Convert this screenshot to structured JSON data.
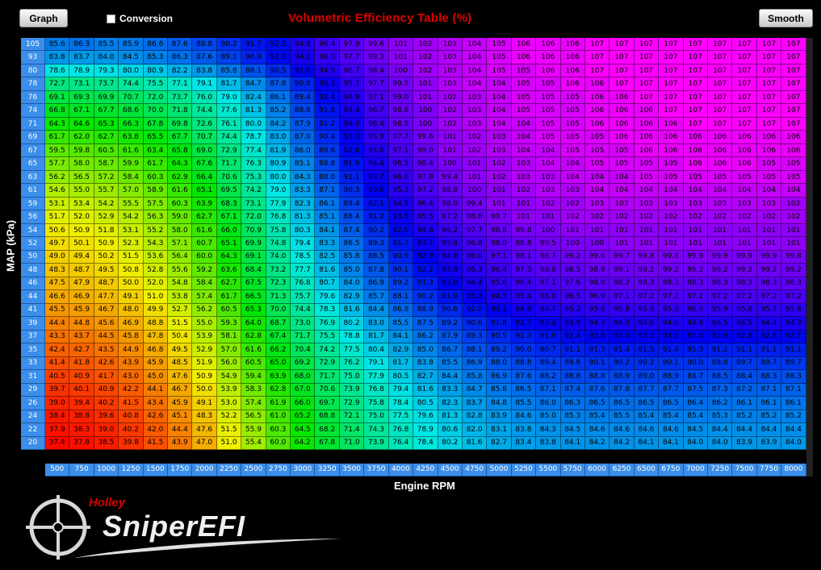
{
  "toolbar": {
    "graph_label": "Graph",
    "conversion_label": "Conversion",
    "smooth_label": "Smooth"
  },
  "title": "Volumetric Efficiency Table (%)",
  "y_axis_label": "MAP (kPa)",
  "x_axis_label": "Engine RPM",
  "logo": {
    "brand": "Holley",
    "name": "SniperEFI"
  },
  "icons": {
    "logo_mark": "crosshair-icon"
  },
  "table": {
    "rpm": [
      "500",
      "750",
      "1000",
      "1250",
      "1500",
      "1750",
      "2000",
      "2250",
      "2500",
      "2750",
      "3000",
      "3250",
      "3500",
      "3750",
      "4000",
      "4250",
      "4500",
      "4750",
      "5000",
      "5250",
      "5500",
      "5750",
      "6000",
      "6250",
      "6500",
      "6750",
      "7000",
      "7250",
      "7500",
      "7750",
      "8000"
    ],
    "map": [
      "105",
      "93",
      "80",
      "78",
      "76",
      "74",
      "71",
      "69",
      "67",
      "65",
      "63",
      "61",
      "59",
      "56",
      "54",
      "52",
      "50",
      "48",
      "46",
      "44",
      "41",
      "39",
      "37",
      "35",
      "33",
      "31",
      "29",
      "26",
      "24",
      "22",
      "20"
    ],
    "rows": [
      [
        "85.6",
        "86.3",
        "85.5",
        "85.9",
        "86.6",
        "87.6",
        "88.8",
        "90.2",
        "91.7",
        "92.3",
        "94.8",
        "96.4",
        "97.9",
        "99.6",
        "101",
        "102",
        "103",
        "104",
        "105",
        "106",
        "106",
        "106",
        "107",
        "107",
        "107",
        "107",
        "107",
        "107",
        "107",
        "107",
        "107"
      ],
      [
        "83.8",
        "83.7",
        "84.0",
        "84.5",
        "85.3",
        "86.3",
        "87.6",
        "89.1",
        "90.9",
        "92.5",
        "94.2",
        "96.0",
        "97.7",
        "99.3",
        "101",
        "102",
        "103",
        "104",
        "105",
        "106",
        "106",
        "106",
        "107",
        "107",
        "107",
        "107",
        "107",
        "107",
        "107",
        "107",
        "107"
      ],
      [
        "78.6",
        "78.9",
        "79.3",
        "80.0",
        "80.9",
        "82.2",
        "83.8",
        "85.8",
        "88.1",
        "90.5",
        "92.8",
        "94.9",
        "96.7",
        "98.4",
        "100",
        "102",
        "103",
        "104",
        "105",
        "105",
        "106",
        "106",
        "107",
        "107",
        "107",
        "107",
        "107",
        "107",
        "107",
        "107",
        "107"
      ],
      [
        "72.7",
        "73.1",
        "73.7",
        "74.4",
        "75.5",
        "77.1",
        "79.1",
        "81.7",
        "84.7",
        "87.8",
        "90.8",
        "93.5",
        "95.7",
        "97.7",
        "99.5",
        "101",
        "103",
        "104",
        "104",
        "105",
        "105",
        "106",
        "106",
        "107",
        "107",
        "107",
        "107",
        "107",
        "107",
        "107",
        "107"
      ],
      [
        "69.1",
        "69.3",
        "69.9",
        "70.7",
        "72.0",
        "73.7",
        "76.0",
        "79.0",
        "82.4",
        "86.1",
        "89.4",
        "92.4",
        "94.9",
        "97.1",
        "99.0",
        "101",
        "102",
        "103",
        "104",
        "105",
        "105",
        "105",
        "106",
        "106",
        "107",
        "107",
        "107",
        "107",
        "107",
        "107",
        "107"
      ],
      [
        "66.8",
        "67.1",
        "67.7",
        "68.6",
        "70.0",
        "71.8",
        "74.4",
        "77.6",
        "81.3",
        "85.2",
        "88.8",
        "91.8",
        "94.4",
        "96.7",
        "98.8",
        "100",
        "102",
        "103",
        "104",
        "105",
        "105",
        "105",
        "106",
        "106",
        "106",
        "107",
        "107",
        "107",
        "107",
        "107",
        "107"
      ],
      [
        "64.3",
        "64.6",
        "65.3",
        "66.3",
        "67.8",
        "69.8",
        "72.6",
        "76.1",
        "80.0",
        "84.2",
        "87.9",
        "91.2",
        "94.0",
        "96.4",
        "98.5",
        "100",
        "102",
        "103",
        "104",
        "104",
        "105",
        "105",
        "106",
        "106",
        "106",
        "106",
        "107",
        "107",
        "107",
        "107",
        "107"
      ],
      [
        "61.7",
        "62.0",
        "62.7",
        "63.8",
        "65.5",
        "67.7",
        "70.7",
        "74.4",
        "78.7",
        "83.0",
        "87.0",
        "90.4",
        "93.3",
        "95.9",
        "97.7",
        "99.6",
        "101",
        "102",
        "103",
        "104",
        "105",
        "105",
        "105",
        "106",
        "106",
        "106",
        "106",
        "106",
        "106",
        "106",
        "106"
      ],
      [
        "59.5",
        "59.8",
        "60.5",
        "61.6",
        "63.4",
        "65.8",
        "69.0",
        "72.9",
        "77.4",
        "81.9",
        "86.0",
        "89.6",
        "92.6",
        "95.0",
        "97.1",
        "99.0",
        "101",
        "102",
        "103",
        "104",
        "104",
        "105",
        "105",
        "105",
        "106",
        "106",
        "106",
        "106",
        "106",
        "106",
        "106"
      ],
      [
        "57.7",
        "58.0",
        "58.7",
        "59.9",
        "61.7",
        "64.3",
        "67.6",
        "71.7",
        "76.3",
        "80.9",
        "85.1",
        "88.8",
        "91.9",
        "94.4",
        "96.5",
        "98.4",
        "100",
        "101",
        "102",
        "103",
        "104",
        "104",
        "105",
        "105",
        "105",
        "105",
        "106",
        "106",
        "106",
        "105",
        "105"
      ],
      [
        "56.2",
        "56.5",
        "57.2",
        "58.4",
        "60.3",
        "62.9",
        "66.4",
        "70.6",
        "75.3",
        "80.0",
        "84.3",
        "88.0",
        "91.1",
        "93.7",
        "96.0",
        "97.8",
        "99.4",
        "101",
        "102",
        "103",
        "103",
        "104",
        "104",
        "104",
        "105",
        "105",
        "105",
        "105",
        "105",
        "105",
        "105"
      ],
      [
        "54.6",
        "55.0",
        "55.7",
        "57.0",
        "58.9",
        "61.6",
        "65.1",
        "69.5",
        "74.2",
        "79.0",
        "83.3",
        "87.1",
        "90.3",
        "93.0",
        "95.3",
        "97.2",
        "98.8",
        "100",
        "101",
        "102",
        "103",
        "103",
        "104",
        "104",
        "104",
        "104",
        "104",
        "104",
        "104",
        "104",
        "104"
      ],
      [
        "53.1",
        "53.4",
        "54.2",
        "55.5",
        "57.5",
        "60.3",
        "63.9",
        "68.3",
        "73.1",
        "77.9",
        "82.3",
        "86.1",
        "89.4",
        "92.1",
        "94.5",
        "96.4",
        "98.0",
        "99.4",
        "101",
        "101",
        "102",
        "102",
        "103",
        "103",
        "103",
        "103",
        "103",
        "103",
        "103",
        "103",
        "102"
      ],
      [
        "51.7",
        "52.0",
        "52.9",
        "54.2",
        "56.3",
        "59.0",
        "62.7",
        "67.1",
        "72.0",
        "76.8",
        "81.3",
        "85.1",
        "88.4",
        "91.2",
        "93.6",
        "95.5",
        "97.2",
        "98.6",
        "99.7",
        "101",
        "101",
        "102",
        "102",
        "102",
        "102",
        "102",
        "102",
        "102",
        "102",
        "102",
        "102"
      ],
      [
        "50.6",
        "50.9",
        "51.8",
        "53.1",
        "55.2",
        "58.0",
        "61.6",
        "66.0",
        "70.9",
        "75.8",
        "80.3",
        "84.1",
        "87.4",
        "90.2",
        "92.6",
        "94.6",
        "96.2",
        "97.7",
        "98.8",
        "99.8",
        "100",
        "101",
        "101",
        "101",
        "101",
        "101",
        "101",
        "101",
        "101",
        "101",
        "101"
      ],
      [
        "49.7",
        "50.1",
        "50.9",
        "52.3",
        "54.3",
        "57.1",
        "60.7",
        "65.1",
        "69.9",
        "74.8",
        "79.4",
        "83.3",
        "86.5",
        "89.3",
        "91.7",
        "93.7",
        "95.4",
        "96.8",
        "98.0",
        "98.8",
        "99.5",
        "100",
        "100",
        "101",
        "101",
        "101",
        "101",
        "101",
        "101",
        "101",
        "101"
      ],
      [
        "49.0",
        "49.4",
        "50.2",
        "51.5",
        "53.6",
        "56.4",
        "60.0",
        "64.3",
        "69.1",
        "74.0",
        "78.5",
        "82.5",
        "85.8",
        "88.5",
        "90.9",
        "92.9",
        "94.6",
        "96.0",
        "97.1",
        "98.1",
        "98.7",
        "99.2",
        "99.6",
        "99.7",
        "99.8",
        "99.8",
        "99.9",
        "99.9",
        "99.9",
        "99.9",
        "99.8"
      ],
      [
        "48.3",
        "48.7",
        "49.5",
        "50.8",
        "52.8",
        "55.6",
        "59.2",
        "63.6",
        "68.4",
        "73.2",
        "77.7",
        "81.6",
        "85.0",
        "87.8",
        "90.1",
        "92.2",
        "93.9",
        "95.3",
        "96.4",
        "97.3",
        "98.0",
        "98.5",
        "98.8",
        "99.1",
        "99.2",
        "99.2",
        "99.2",
        "99.2",
        "99.2",
        "99.2",
        "99.2"
      ],
      [
        "47.5",
        "47.9",
        "48.7",
        "50.0",
        "52.0",
        "54.8",
        "58.4",
        "62.7",
        "67.5",
        "72.3",
        "76.8",
        "80.7",
        "84.0",
        "86.9",
        "89.2",
        "91.3",
        "93.0",
        "94.4",
        "95.6",
        "96.4",
        "97.1",
        "97.6",
        "98.0",
        "98.2",
        "98.3",
        "98.3",
        "98.3",
        "98.3",
        "98.3",
        "98.3",
        "98.3"
      ],
      [
        "46.6",
        "46.9",
        "47.7",
        "49.1",
        "51.0",
        "53.8",
        "57.4",
        "61.7",
        "66.5",
        "71.3",
        "75.7",
        "79.6",
        "82.9",
        "85.7",
        "88.1",
        "90.2",
        "91.9",
        "93.3",
        "94.5",
        "95.4",
        "96.0",
        "96.5",
        "96.9",
        "97.1",
        "97.2",
        "97.2",
        "97.2",
        "97.2",
        "97.2",
        "97.2",
        "97.2"
      ],
      [
        "45.5",
        "45.9",
        "46.7",
        "48.0",
        "49.9",
        "52.7",
        "56.2",
        "60.5",
        "65.3",
        "70.0",
        "74.4",
        "78.3",
        "81.6",
        "84.4",
        "86.8",
        "88.9",
        "90.6",
        "92.0",
        "93.1",
        "94.0",
        "94.7",
        "95.2",
        "95.6",
        "95.8",
        "95.9",
        "95.9",
        "96.0",
        "95.9",
        "95.8",
        "95.7",
        "95.6"
      ],
      [
        "44.4",
        "44.8",
        "45.6",
        "46.9",
        "48.8",
        "51.5",
        "55.0",
        "59.3",
        "64.0",
        "68.7",
        "73.0",
        "76.9",
        "80.2",
        "83.0",
        "85.5",
        "87.5",
        "89.2",
        "90.6",
        "91.8",
        "92.7",
        "93.4",
        "93.9",
        "94.3",
        "94.5",
        "94.6",
        "94.6",
        "94.6",
        "94.5",
        "94.5",
        "94.4",
        "94.3"
      ],
      [
        "43.3",
        "43.7",
        "44.5",
        "45.8",
        "47.8",
        "50.4",
        "53.9",
        "58.1",
        "62.8",
        "67.4",
        "71.7",
        "75.5",
        "78.8",
        "81.7",
        "84.1",
        "86.2",
        "87.9",
        "89.3",
        "90.5",
        "91.3",
        "91.9",
        "92.4",
        "92.8",
        "93.0",
        "93.1",
        "93.1",
        "93.0",
        "92.9",
        "92.8",
        "92.8",
        "92.7"
      ],
      [
        "42.4",
        "42.7",
        "43.5",
        "44.9",
        "46.8",
        "49.5",
        "52.9",
        "57.0",
        "61.6",
        "66.2",
        "70.4",
        "74.2",
        "77.5",
        "80.4",
        "82.9",
        "85.0",
        "86.7",
        "88.1",
        "89.2",
        "90.0",
        "90.7",
        "91.1",
        "91.3",
        "91.4",
        "91.5",
        "91.4",
        "91.3",
        "91.2",
        "91.1",
        "91.1",
        "91.1"
      ],
      [
        "41.4",
        "41.8",
        "42.6",
        "43.9",
        "45.9",
        "48.5",
        "51.9",
        "56.0",
        "60.5",
        "65.0",
        "69.2",
        "72.9",
        "76.2",
        "79.1",
        "81.7",
        "83.8",
        "85.5",
        "86.9",
        "88.0",
        "88.8",
        "89.4",
        "89.8",
        "90.1",
        "90.2",
        "90.2",
        "90.1",
        "90.0",
        "89.8",
        "89.7",
        "89.7",
        "89.7"
      ],
      [
        "40.5",
        "40.9",
        "41.7",
        "43.0",
        "45.0",
        "47.6",
        "50.9",
        "54.9",
        "59.4",
        "63.9",
        "68.0",
        "71.7",
        "75.0",
        "77.9",
        "80.5",
        "82.7",
        "84.4",
        "85.8",
        "86.9",
        "87.6",
        "88.2",
        "88.8",
        "88.8",
        "88.9",
        "89.0",
        "88.9",
        "88.7",
        "88.5",
        "88.4",
        "88.3",
        "88.3"
      ],
      [
        "39.7",
        "40.1",
        "40.9",
        "42.2",
        "44.1",
        "46.7",
        "50.0",
        "53.9",
        "58.3",
        "62.8",
        "67.0",
        "70.6",
        "73.9",
        "76.8",
        "79.4",
        "81.6",
        "83.3",
        "84.7",
        "85.8",
        "86.5",
        "87.1",
        "87.4",
        "87.6",
        "87.8",
        "87.7",
        "87.7",
        "87.5",
        "87.3",
        "87.2",
        "87.1",
        "87.1"
      ],
      [
        "39.0",
        "39.4",
        "40.2",
        "41.5",
        "43.4",
        "45.9",
        "49.1",
        "53.0",
        "57.4",
        "61.9",
        "66.0",
        "69.7",
        "72.9",
        "75.8",
        "78.4",
        "80.5",
        "82.3",
        "83.7",
        "84.8",
        "85.5",
        "86.0",
        "86.3",
        "86.5",
        "86.5",
        "86.5",
        "86.5",
        "86.4",
        "86.2",
        "86.1",
        "86.1",
        "86.1"
      ],
      [
        "38.4",
        "38.8",
        "39.6",
        "40.8",
        "42.6",
        "45.1",
        "48.3",
        "52.2",
        "56.5",
        "61.0",
        "65.2",
        "68.8",
        "72.1",
        "75.0",
        "77.5",
        "79.6",
        "81.3",
        "82.8",
        "83.9",
        "84.6",
        "85.0",
        "85.3",
        "85.4",
        "85.5",
        "85.4",
        "85.4",
        "85.4",
        "85.3",
        "85.2",
        "85.2",
        "85.2"
      ],
      [
        "37.9",
        "38.3",
        "39.0",
        "40.2",
        "42.0",
        "44.4",
        "47.6",
        "51.5",
        "55.9",
        "60.3",
        "64.5",
        "68.2",
        "71.4",
        "74.3",
        "76.8",
        "78.9",
        "80.6",
        "82.0",
        "83.1",
        "83.8",
        "84.3",
        "84.5",
        "84.6",
        "84.6",
        "84.6",
        "84.6",
        "84.5",
        "84.4",
        "84.4",
        "84.4",
        "84.4"
      ],
      [
        "37.4",
        "37.8",
        "38.5",
        "39.8",
        "41.5",
        "43.9",
        "47.0",
        "51.0",
        "55.4",
        "60.0",
        "64.2",
        "67.8",
        "71.0",
        "73.9",
        "76.4",
        "78.4",
        "80.2",
        "81.6",
        "82.7",
        "83.4",
        "83.8",
        "84.1",
        "84.2",
        "84.2",
        "84.1",
        "84.1",
        "84.0",
        "84.0",
        "83.9",
        "83.9",
        "84.0"
      ]
    ]
  }
}
